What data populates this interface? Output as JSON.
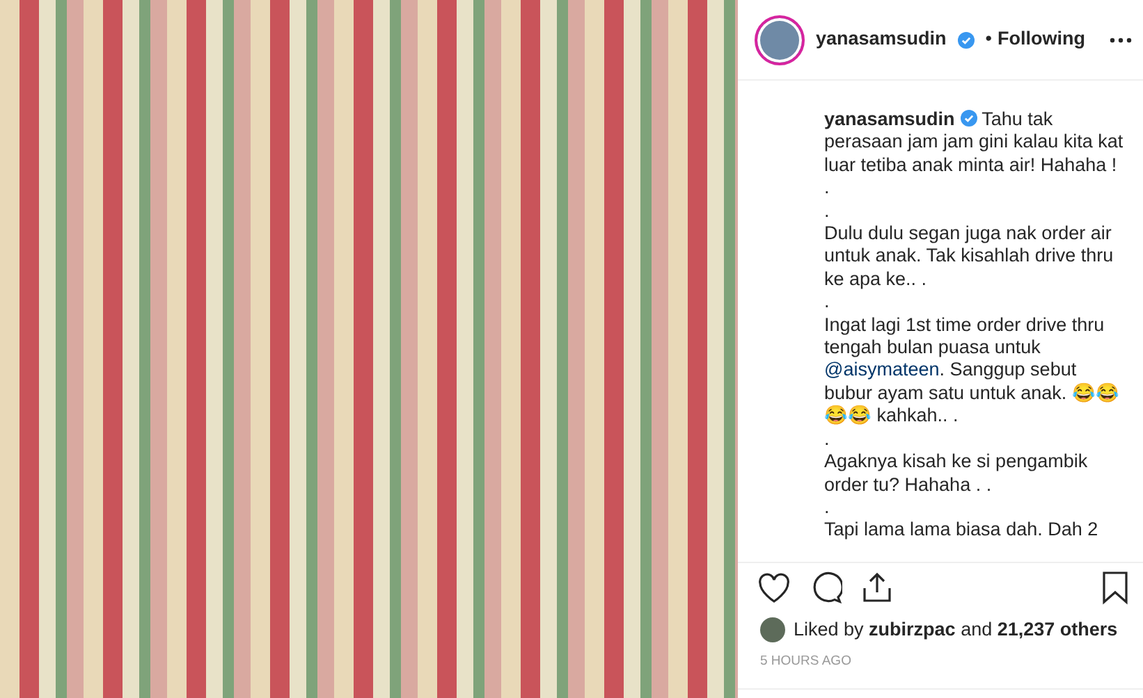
{
  "post": {
    "header": {
      "username": "yanasamsudin",
      "verified": true,
      "separator": "•",
      "follow_label": "Following"
    },
    "caption": {
      "username": "yanasamsudin",
      "verified": true,
      "paragraphs": [
        [
          {
            "kind": "text",
            "text": "Tahu tak perasaan jam jam gini kalau kita kat luar tetiba anak minta air! Hahaha !"
          }
        ],
        [
          {
            "kind": "text",
            "text": "."
          }
        ],
        [
          {
            "kind": "text",
            "text": "."
          }
        ],
        [
          {
            "kind": "text",
            "text": "Dulu dulu segan juga nak order air untuk anak. Tak kisahlah drive thru ke apa ke.. ."
          }
        ],
        [
          {
            "kind": "text",
            "text": "."
          }
        ],
        [
          {
            "kind": "text",
            "text": "Ingat lagi 1st time order drive thru tengah bulan puasa untuk "
          },
          {
            "kind": "mention",
            "text": "@aisymateen"
          },
          {
            "kind": "text",
            "text": ". Sanggup sebut bubur ayam satu untuk anak. 😂😂😂😂 kahkah.. ."
          }
        ],
        [
          {
            "kind": "text",
            "text": "."
          }
        ],
        [
          {
            "kind": "text",
            "text": "Agaknya kisah ke si pengambik order tu? Hahaha . ."
          }
        ],
        [
          {
            "kind": "text",
            "text": "."
          }
        ],
        [
          {
            "kind": "text",
            "text": "Tapi lama lama biasa dah. Dah 2"
          }
        ]
      ]
    },
    "liked": false,
    "saved": false,
    "likes": "Liked by **zubirzpac** and **21,237 others**",
    "time": "5 HOURS AGO"
  }
}
